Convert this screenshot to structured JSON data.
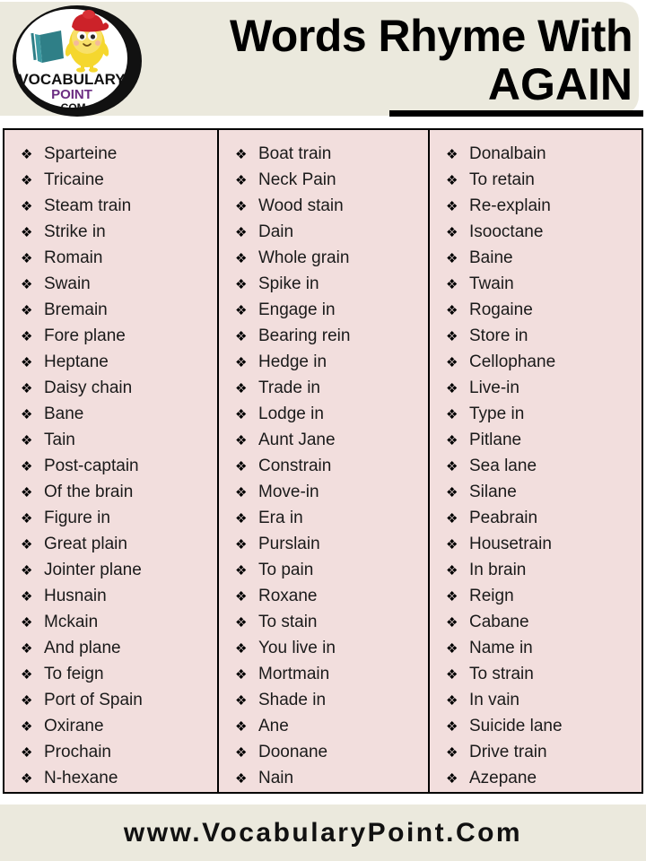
{
  "header": {
    "title_line1": "Words Rhyme With",
    "title_line2": "AGAIN",
    "logo": {
      "name": "vocabulary-point-logo",
      "text_top": "VOCABULARY",
      "text_middle": "POINT",
      "text_bottom": ".COM",
      "colors": {
        "ring": "#111111",
        "face": "#ffffff",
        "word_top": "#111111",
        "word_middle": "#6b2d82",
        "word_bottom": "#111111",
        "mascot_body": "#f5d72e",
        "mascot_cap": "#cc2229",
        "book": "#2f7f87"
      }
    }
  },
  "colors": {
    "header_background": "#ebe9dd",
    "table_background": "#f2dedd",
    "table_border": "#000000",
    "footer_background": "#ebe9dd",
    "text": "#1a1a1a"
  },
  "bullet_glyph": "❖",
  "columns": [
    {
      "name": "word-column-1",
      "items": [
        "Sparteine",
        "Tricaine",
        "Steam train",
        "Strike in",
        "Romain",
        "Swain",
        "Bremain",
        "Fore plane",
        "Heptane",
        "Daisy chain",
        "Bane",
        "Tain",
        "Post-captain",
        "Of the brain",
        "Figure in",
        "Great plain",
        "Jointer plane",
        "Husnain",
        "Mckain",
        "And plane",
        "To feign",
        "Port of Spain",
        "Oxirane",
        "Prochain",
        "N-hexane"
      ]
    },
    {
      "name": "word-column-2",
      "items": [
        "Boat train",
        "Neck Pain",
        "Wood stain",
        "Dain",
        "Whole grain",
        "Spike in",
        "Engage in",
        "Bearing rein",
        "Hedge in",
        "Trade in",
        "Lodge in",
        "Aunt Jane",
        "Constrain",
        "Move-in",
        "Era in",
        "Purslain",
        "To pain",
        "Roxane",
        "To stain",
        "You live in",
        "Mortmain",
        "Shade in",
        "Ane",
        "Doonane",
        "Nain"
      ]
    },
    {
      "name": "word-column-3",
      "items": [
        "Donalbain",
        "To retain",
        "Re-explain",
        "Isooctane",
        "Baine",
        "Twain",
        "Rogaine",
        "Store in",
        "Cellophane",
        "Live-in",
        "Type in",
        "Pitlane",
        "Sea lane",
        "Silane",
        "Peabrain",
        "Housetrain",
        "In brain",
        "Reign",
        "Cabane",
        "Name in",
        "To strain",
        "In vain",
        "Suicide lane",
        "Drive train",
        "Azepane"
      ]
    }
  ],
  "footer": {
    "text": "www.VocabularyPoint.Com"
  }
}
